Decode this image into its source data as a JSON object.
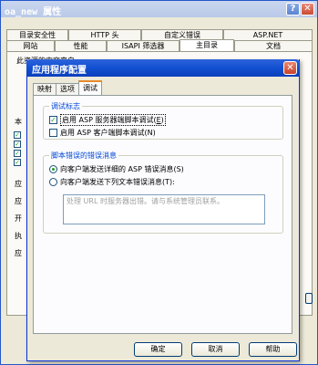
{
  "outer_window": {
    "title": "oa_new 属性",
    "tabs_row1": [
      "目录安全性",
      "HTTP 头",
      "自定义错误",
      "ASP.NET"
    ],
    "tabs_row2": [
      "网站",
      "性能",
      "ISAPI 筛选器",
      "主目录",
      "文档"
    ],
    "selected_tab": "主目录",
    "content_source_label": "此资源的内容来自:",
    "side_labels": [
      "本",
      "应",
      "应",
      "开",
      "执",
      "应"
    ]
  },
  "dialog": {
    "title": "应用程序配置",
    "tabs": [
      "映射",
      "选项",
      "调试"
    ],
    "selected_tab": "调试",
    "debug_flags": {
      "group_label": "调试标志",
      "server_debug_label": "启用 ASP 服务器端脚本调试(",
      "server_debug_hotkey": "E",
      "server_debug_checked": true,
      "client_debug_label": "启用 ASP 客户端脚本调试(N)",
      "client_debug_checked": false
    },
    "error_messages": {
      "group_label": "脚本错误的错误消息",
      "detailed_label": "向客户端发送详细的 ASP 错误消息(S)",
      "detailed_selected": true,
      "text_label": "向客户端发送下列文本错误消息(T):",
      "text_selected": false,
      "message_text": "处理 URL 时服务器出错。请与系统管理员联系。"
    },
    "buttons": {
      "ok": "确定",
      "cancel": "取消",
      "help": "帮助"
    }
  },
  "colors": {
    "dialog_title_bar": "#0a3fbd",
    "group_label": "#0046d5",
    "check_mark": "#21a121",
    "focus_tab_accent": "#e68b2c"
  }
}
